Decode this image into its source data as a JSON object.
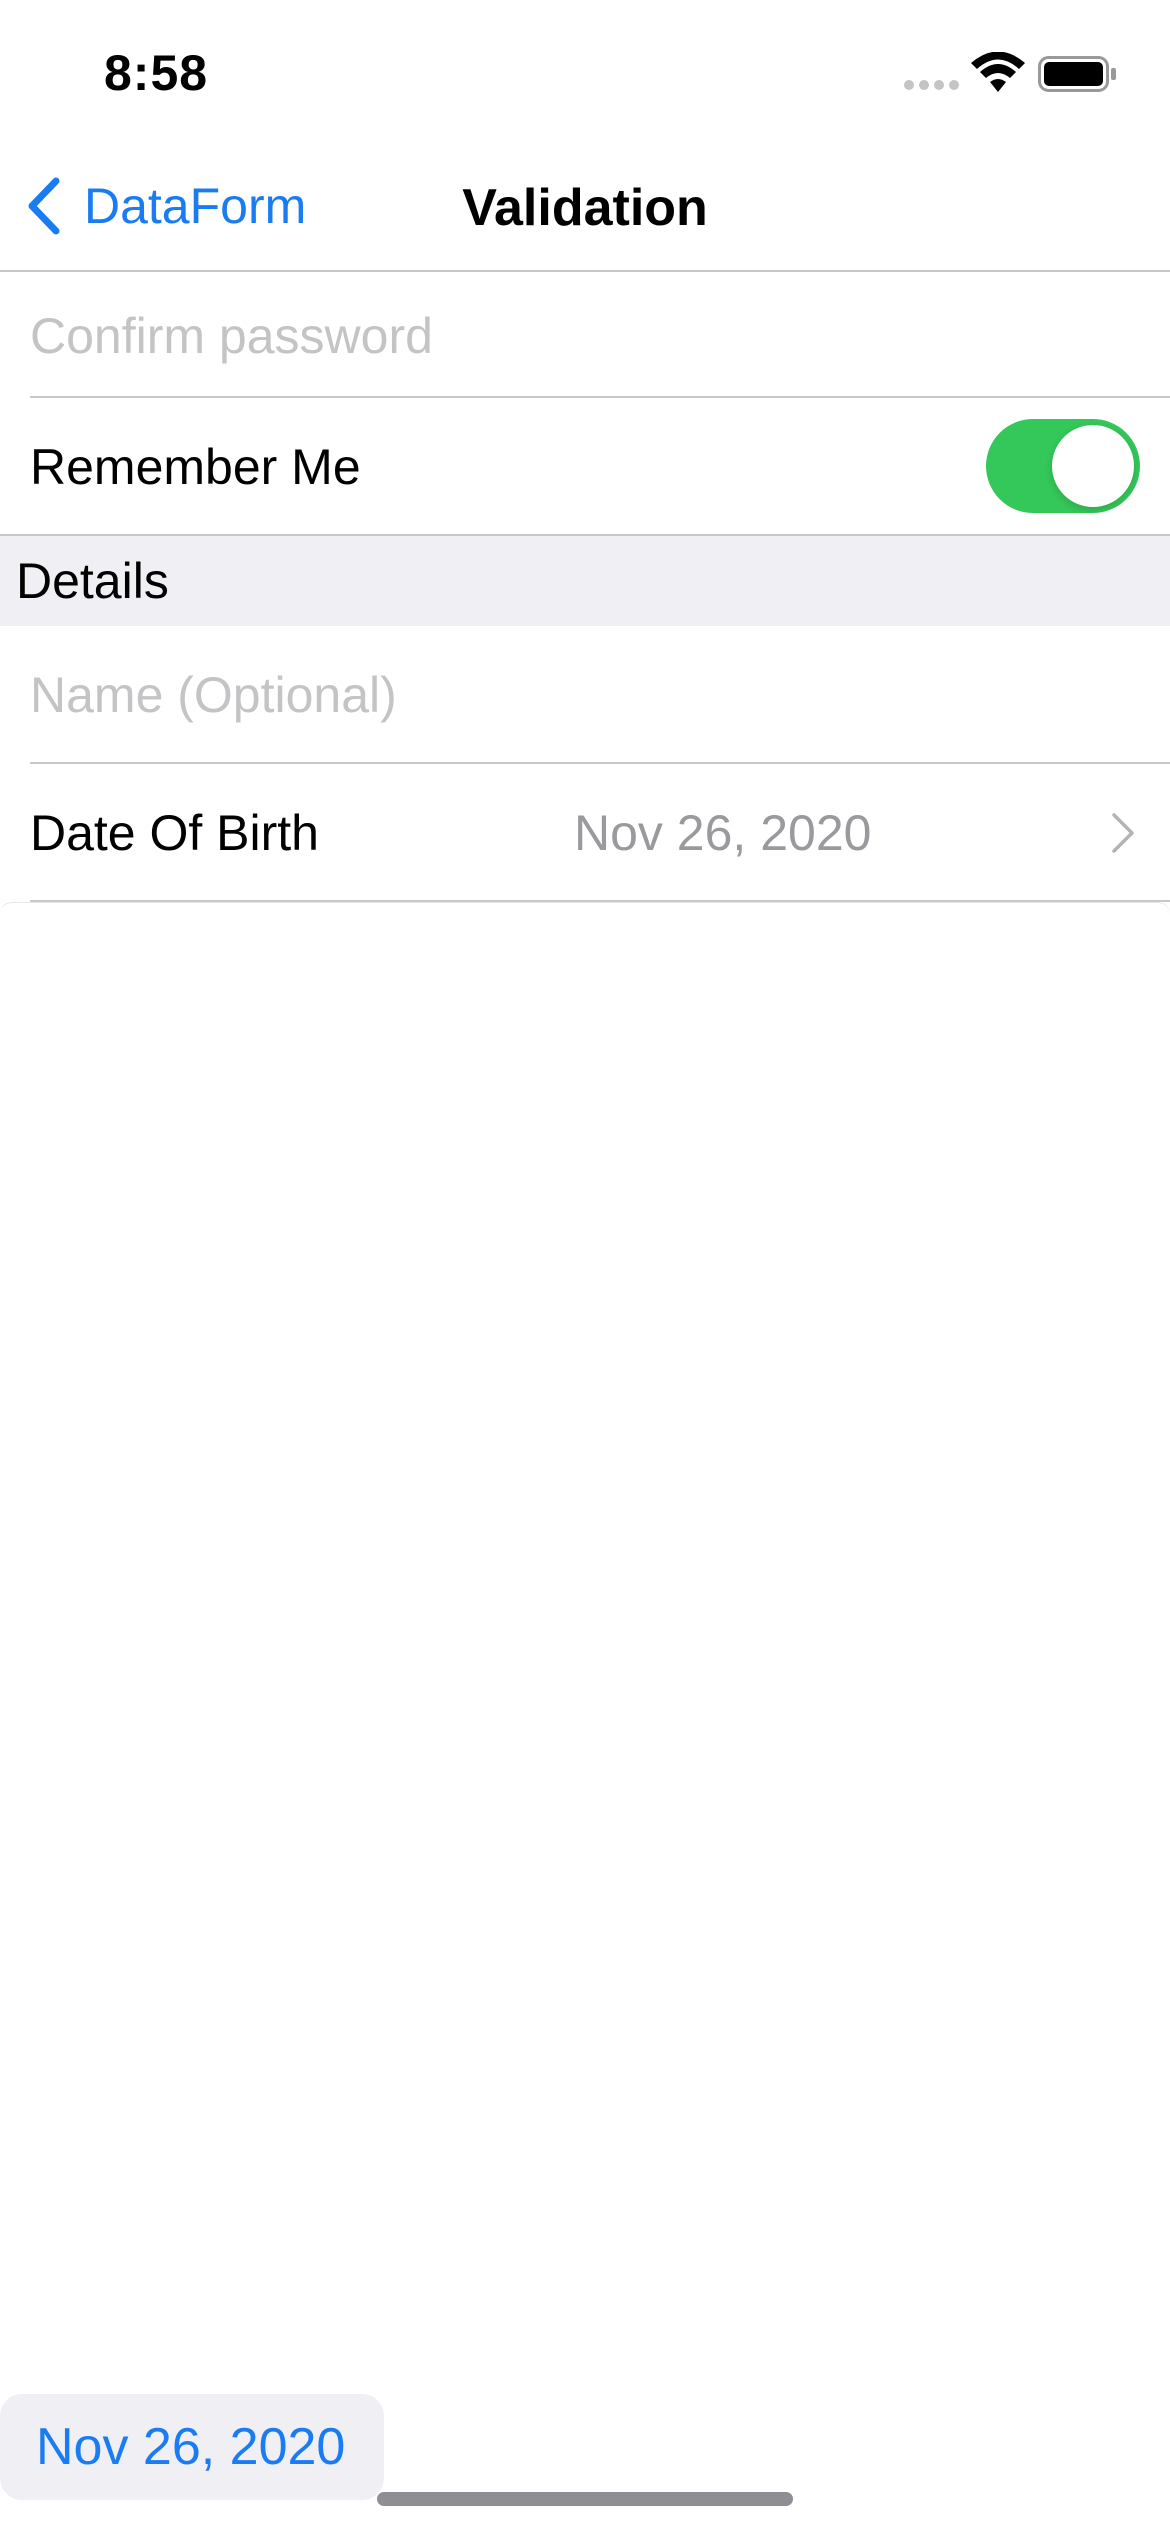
{
  "status_bar": {
    "time": "8:58",
    "icons": [
      "cellular-signal-icon",
      "wifi-icon",
      "battery-icon"
    ]
  },
  "nav": {
    "back_label": "DataForm",
    "title": "Validation",
    "accent_color": "#1a7cf2"
  },
  "form": {
    "confirm_password_placeholder": "Confirm password",
    "remember_me_label": "Remember Me",
    "remember_me_on": true,
    "toggle_color": "#34c759",
    "details_section_title": "Details",
    "name_placeholder": "Name (Optional)",
    "dob_label": "Date Of Birth",
    "dob_value": "Nov 26, 2020"
  },
  "date_picker_sheet": {
    "selected_date": "Nov 26, 2020"
  }
}
